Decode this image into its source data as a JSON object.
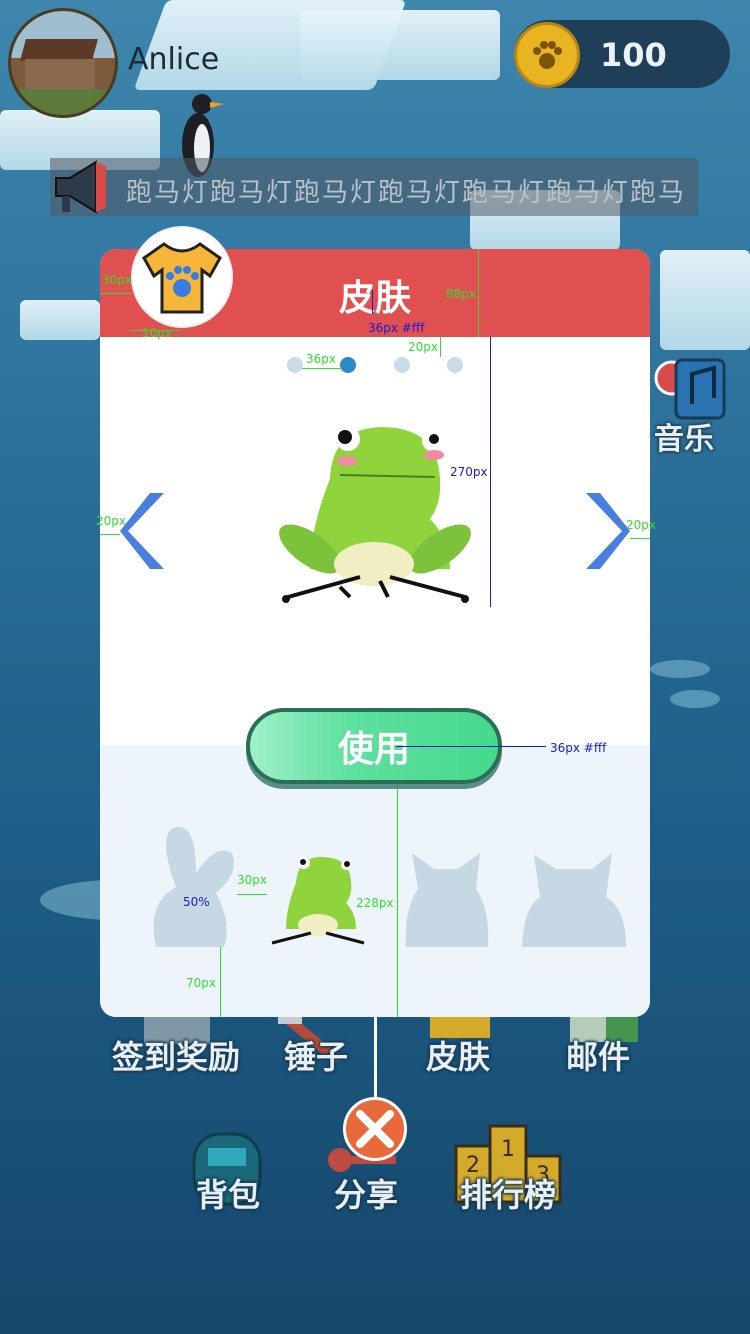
{
  "user": {
    "name": "Anlice",
    "coins": "100"
  },
  "marquee": {
    "text": "跑马灯跑马灯跑马灯跑马灯跑马灯跑马灯跑马"
  },
  "side": {
    "music_label": "音乐"
  },
  "menu": {
    "row1": [
      "签到奖励",
      "锤子",
      "皮肤",
      "邮件"
    ],
    "row2": [
      "背包",
      "分享",
      "排行榜"
    ]
  },
  "modal": {
    "title": "皮肤",
    "use_button": "使用",
    "carousel": {
      "total": 4,
      "active_index": 1
    },
    "skins": [
      "rabbit",
      "frog",
      "cat",
      "bear"
    ],
    "selected_skin": "frog"
  },
  "annotations": {
    "a1": "30px",
    "a2": "10px",
    "a3": "88px",
    "a4": "36px #fff",
    "a5": "36px",
    "a6": "20px",
    "a7": "270px",
    "a8": "20px",
    "a9": "20px",
    "a10": "36px #fff",
    "a11": "50%",
    "a12": "30px",
    "a13": "228px",
    "a14": "70px"
  },
  "colors": {
    "header_red": "#e05050",
    "accent_blue": "#2c89c4",
    "button_green": "#44d98a",
    "close_orange": "#e8693a",
    "annotation_green": "#33dd33",
    "annotation_blue": "#1a1ad0"
  }
}
